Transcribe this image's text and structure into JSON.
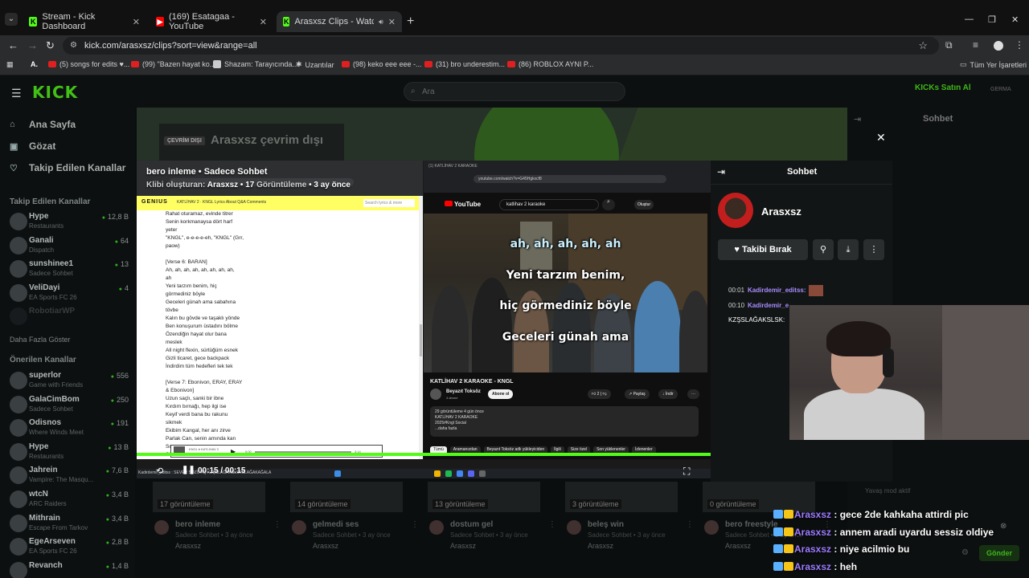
{
  "browser": {
    "tabs": [
      {
        "label": "Stream - Kick Dashboard",
        "fav": "K"
      },
      {
        "label": "(169) Esatagaa - YouTube",
        "fav": "▶"
      },
      {
        "label": "Arasxsz Clips - Watch Live o",
        "fav": "K"
      }
    ],
    "url": "kick.com/arasxsz/clips?sort=view&range=all",
    "bookmarks": [
      "(5) songs for edits ♥...",
      "(99) \"Bazen hayat ko...",
      "Shazam: Tarayıcında...",
      "Uzantılar",
      "(98) keko eee eee -...",
      "(31) bro underestim...",
      "(86) ROBLOX AYNI P..."
    ],
    "bookmark_all": "Tüm Yer İşaretleri"
  },
  "kick": {
    "logo": "KICK",
    "search_placeholder": "Ara",
    "kicks_label": "KICKs Satın Al",
    "kicks_extra": "GERMA",
    "nav": [
      {
        "label": "Ana Sayfa",
        "icon": "⌂"
      },
      {
        "label": "Gözat",
        "icon": "▣"
      },
      {
        "label": "Takip Edilen Kanallar",
        "icon": "♡"
      }
    ],
    "followed_title": "Takip Edilen Kanallar",
    "followed": [
      {
        "name": "Hype",
        "cat": "Restaurants",
        "viewers": "12,8 B"
      },
      {
        "name": "Ganali",
        "cat": "Dispatch",
        "viewers": "64"
      },
      {
        "name": "sunshinee1",
        "cat": "Sadece Sohbet",
        "viewers": "13"
      },
      {
        "name": "VeliDayi",
        "cat": "EA Sports FC 26",
        "viewers": "4"
      },
      {
        "name": "RobotiarWP",
        "cat": "",
        "viewers": ""
      }
    ],
    "show_more": "Daha Fazla Göster",
    "suggested_title": "Önerilen Kanallar",
    "suggested": [
      {
        "name": "superlor",
        "cat": "Game with Friends",
        "viewers": "556"
      },
      {
        "name": "GalaCimBom",
        "cat": "Sadece Sohbet",
        "viewers": "250"
      },
      {
        "name": "Odisnos",
        "cat": "Where Winds Meet",
        "viewers": "191"
      },
      {
        "name": "Hype",
        "cat": "Restaurants",
        "viewers": "13 B"
      },
      {
        "name": "Jahrein",
        "cat": "Vampire: The Masqu...",
        "viewers": "7,6 B"
      },
      {
        "name": "wtcN",
        "cat": "ARC Raiders",
        "viewers": "3,4 B"
      },
      {
        "name": "Mithrain",
        "cat": "Escape From Tarkov",
        "viewers": "3,4 B"
      },
      {
        "name": "EgeArseven",
        "cat": "EA Sports FC 26",
        "viewers": "2,8 B"
      },
      {
        "name": "Revanch",
        "cat": "",
        "viewers": "1,4 B"
      }
    ],
    "offline_tag": "ÇEVRİM DIŞI",
    "offline_text": "Arasxsz çevrim dışı",
    "bg_chat_title": "Sohbet",
    "clips": [
      {
        "views": "17 görüntüleme",
        "title": "bero inleme",
        "sub": "Sadece Sohbet • 3 ay önce",
        "owner": "Arasxsz"
      },
      {
        "views": "14 görüntüleme",
        "title": "gelmedi ses",
        "sub": "Sadece Sohbet • 3 ay önce",
        "owner": "Arasxsz"
      },
      {
        "views": "13 görüntüleme",
        "title": "dostum gel",
        "sub": "Sadece Sohbet • 3 ay önce",
        "owner": "Arasxsz"
      },
      {
        "views": "3 görüntüleme",
        "title": "beleş win",
        "sub": "Sadece Sohbet • 3 ay önce",
        "owner": "Arasxsz"
      },
      {
        "views": "0 görüntüleme",
        "title": "bero freestyle",
        "sub": "Sadece Sohbet • 3 ay önce",
        "owner": "Arasxsz"
      }
    ]
  },
  "modal": {
    "clip_title": "bero inleme",
    "clip_category": "Sadece Sohbet",
    "creator_label": "Klibi oluşturan:",
    "creator": "Arasxsz",
    "views_count": "17",
    "views_label": "Görüntüleme",
    "age": "3 ay önce",
    "time": "00:15 / 00:15",
    "progress": 1.0,
    "chat_title": "Sohbet",
    "channel_name": "Arasxsz",
    "unfollow_label": "Takibi Bırak",
    "messages": [
      {
        "time": "00:01",
        "user": "Kadirdemir_editss:",
        "text": ""
      },
      {
        "time": "00:10",
        "user": "Kadirdemir_e",
        "text": "KZŞSLAĞAKSLSK:"
      }
    ],
    "taskbar_text": "Kadirdemir_editss : SEVER SÖZÜ AQ KZŞSLAĞAKSLSKSLAĞAKAĞALA"
  },
  "genius": {
    "logo": "GENIUS",
    "nav": "KATLİHAV 2 · KNGL   Lyrics   About   Q&A   Comments",
    "search": "Search lyrics & more",
    "lyrics": "Rahat oturamaz, evinde titrer\nSenin korkmanaysa dört harf\nyeter\n\"KNGL\", e-e-e-e-eh, \"KNGL\" (Grr,\npaow)\n\n[Verse 6: BARAN]\nAh, ah, ah, ah, ah, ah, ah, ah,\nah\nYeni tarzım benim, hiç\ngörmediniz böyle\nGeceleri günah ama sabahına\ntövbe\nKalın bu gövde ve taşaklı yönde\nBen konuşurum üstadını bölme\nÖzendiğin hayat olur bana\nmeslek\nAll night flexin, sürtüğüm esnek\nGizli ticaret, gece backpack\nİndirdim tüm hedefleri tek tek\n\n[Verse 7: Ebonivon, ERAY, ERAY\n& Ebonivon]\nUzun saçlı, sanki bir ibne\nKırdım bırnağı, hep ilgi ise\nKeyif verdi bana bu rakunu\nsikmek\nEkibim Kangal, her anı zirve\nParlak Can, senin amında kan\nSo\nSikimi yalarsın dökülp bal",
    "player_label": "KNGL ♦ KATLİHAV 2",
    "player_time_start": "0:00",
    "player_time_end": "3:14"
  },
  "youtube": {
    "tab": "(1) KATLİHAV 2 KARAOKE",
    "url": "youtube.com/watch?v=G45Hgkxcf8",
    "query": "katlihav 2 karaoke",
    "create": "Oluştur",
    "karaoke_lines": [
      "ah, ah, ah, ah, ah",
      "Yeni tarzım benim,",
      "hiç görmediniz böyle",
      "Geceleri günah ama"
    ],
    "title": "KATLİHAV 2 KARAOKE - KNGL",
    "channel": "Beyazıt Toksöz",
    "subs": "4 abone",
    "subscribe": "Abone ol",
    "likes": "2",
    "share": "Paylaş",
    "download": "İndir",
    "desc": "29 görüntüleme  4 gün önce\nKATLİHAV 2 KARAOKE\n2025#Kngl Social\n...daha fazla",
    "chips": [
      "Tümü",
      "Aramanızdan",
      "Beyazıt Toksöz adlı yükleyiciden",
      "İlgili",
      "Size özel",
      "Son yüklenenler",
      "İzlenenler"
    ]
  },
  "stream_chat": {
    "hint": "Yavaş mod aktif",
    "lines": [
      {
        "user": "Arasxsz",
        "text": " : gece 2de kahkaha attirdi pic"
      },
      {
        "user": "Arasxsz",
        "text": " : annem aradi uyardu sessiz oldiye"
      },
      {
        "user": "Arasxsz",
        "text": " : niye acilmio bu"
      },
      {
        "user": "Arasxsz",
        "text": " : heh"
      }
    ],
    "send": "Gönder"
  },
  "colors": {
    "kick_green": "#53fc18",
    "username": "#9d7bff"
  }
}
